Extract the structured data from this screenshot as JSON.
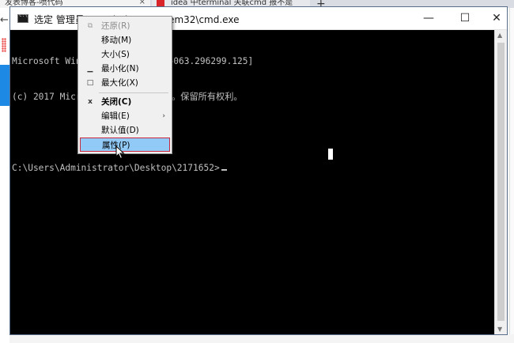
{
  "browser": {
    "tab1_title": "发表博客-喷代码",
    "tab2_title": "idea 中terminal 关联cmd 报不是",
    "tab_close": "×",
    "new_tab": "+",
    "back_arrow": "←"
  },
  "window": {
    "title": "选定 管理员: C:\\Windows\\system32\\cmd.exe",
    "minimize_glyph": "—",
    "maximize_glyph": "☐",
    "close_glyph": "✕"
  },
  "console": {
    "lines": [
      "Microsoft Windows [版本 10.0.15063.296299.125]",
      "(c) 2017 Microsoft Corporation。保留所有权利。",
      "",
      "C:\\Users\\Administrator\\Desktop\\2171652>"
    ]
  },
  "context_menu": {
    "items": [
      {
        "label": "还原(R)",
        "glyph": "⧉",
        "disabled": true
      },
      {
        "label": "移动(M)",
        "glyph": "",
        "disabled": false
      },
      {
        "label": "大小(S)",
        "glyph": "",
        "disabled": false
      },
      {
        "label": "最小化(N)",
        "glyph": "▁",
        "disabled": false
      },
      {
        "label": "最大化(X)",
        "glyph": "□",
        "disabled": false
      },
      {
        "label": "关闭(C)",
        "glyph": "x",
        "disabled": false,
        "bold": true
      },
      {
        "label": "编辑(E)",
        "glyph": "",
        "disabled": false,
        "submenu": "›"
      },
      {
        "label": "默认值(D)",
        "glyph": "",
        "disabled": false
      },
      {
        "label": "属性(P)",
        "glyph": "",
        "disabled": false,
        "highlighted": true
      }
    ]
  },
  "colors": {
    "console_bg": "#000000",
    "console_text": "#c0c0c0",
    "menu_highlight": "#91c9f7",
    "highlight_border": "#c8283e"
  }
}
